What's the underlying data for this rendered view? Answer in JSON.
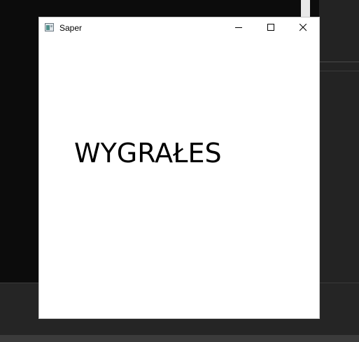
{
  "window": {
    "title": "Saper",
    "icon": "minesweeper-app-icon",
    "controls": {
      "minimize_icon": "minimize-icon",
      "maximize_icon": "maximize-icon",
      "close_icon": "close-icon"
    }
  },
  "content": {
    "message": "WYGRAŁES"
  },
  "colors": {
    "window_background": "#ffffff",
    "desktop_background": "#0c0c0c",
    "text": "#000000"
  }
}
